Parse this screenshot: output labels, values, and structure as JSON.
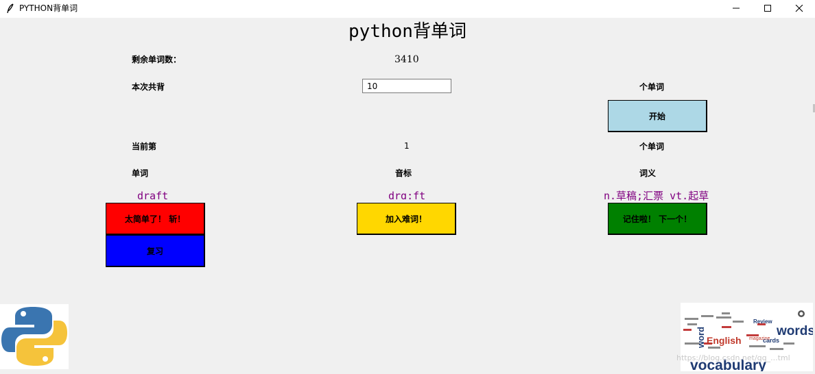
{
  "window": {
    "title": "PYTHON背单词",
    "icon": "feather-icon"
  },
  "heading": "python背单词",
  "remaining": {
    "label": "剩余单词数：",
    "value": "3410"
  },
  "session": {
    "label": "本次共背",
    "count": "10",
    "unit": "个单词",
    "start_label": "开始"
  },
  "progress": {
    "label": "当前第",
    "value": "1",
    "unit": "个单词"
  },
  "columns": {
    "word": "单词",
    "phonetic": "音标",
    "meaning": "词义"
  },
  "card": {
    "word": "draft",
    "phonetic": "drɑ:ft",
    "meaning": "n.草稿;汇票 vt.起草"
  },
  "buttons": {
    "easy": {
      "label": "太简单了！ 斩！",
      "color": "#ff0000"
    },
    "hard": {
      "label": "加入难词！",
      "color": "#ffd700"
    },
    "remembered": {
      "label": "记住啦！ 下一个！",
      "color": "#008000"
    },
    "review": {
      "label": "复习",
      "color": "#0000ff"
    },
    "start_color": "#add8e6"
  },
  "images": {
    "left": "python-logo",
    "right": {
      "name": "vocabulary-word-cloud",
      "words": [
        "words",
        "English",
        "vocabulary",
        "Review",
        "cards",
        "magazine",
        "word"
      ]
    }
  },
  "watermark": "https://blog.csdn.net/qq_...tml"
}
